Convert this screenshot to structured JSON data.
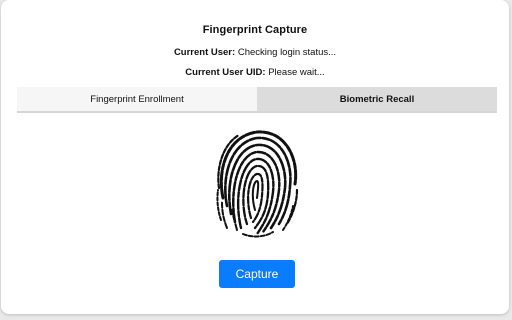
{
  "header": {
    "title": "Fingerprint Capture",
    "current_user_label": "Current User:",
    "current_user_value": "Checking login status...",
    "current_uid_label": "Current User UID:",
    "current_uid_value": "Please wait..."
  },
  "tabs": [
    {
      "label": "Fingerprint Enrollment",
      "active": false
    },
    {
      "label": "Biometric Recall",
      "active": true
    }
  ],
  "fingerprint": {
    "icon": "fingerprint-icon"
  },
  "actions": {
    "capture_label": "Capture"
  },
  "colors": {
    "accent": "#0a7cff",
    "active_tab_bg": "#dcdcdc",
    "inactive_tab_bg": "#f6f6f6"
  }
}
